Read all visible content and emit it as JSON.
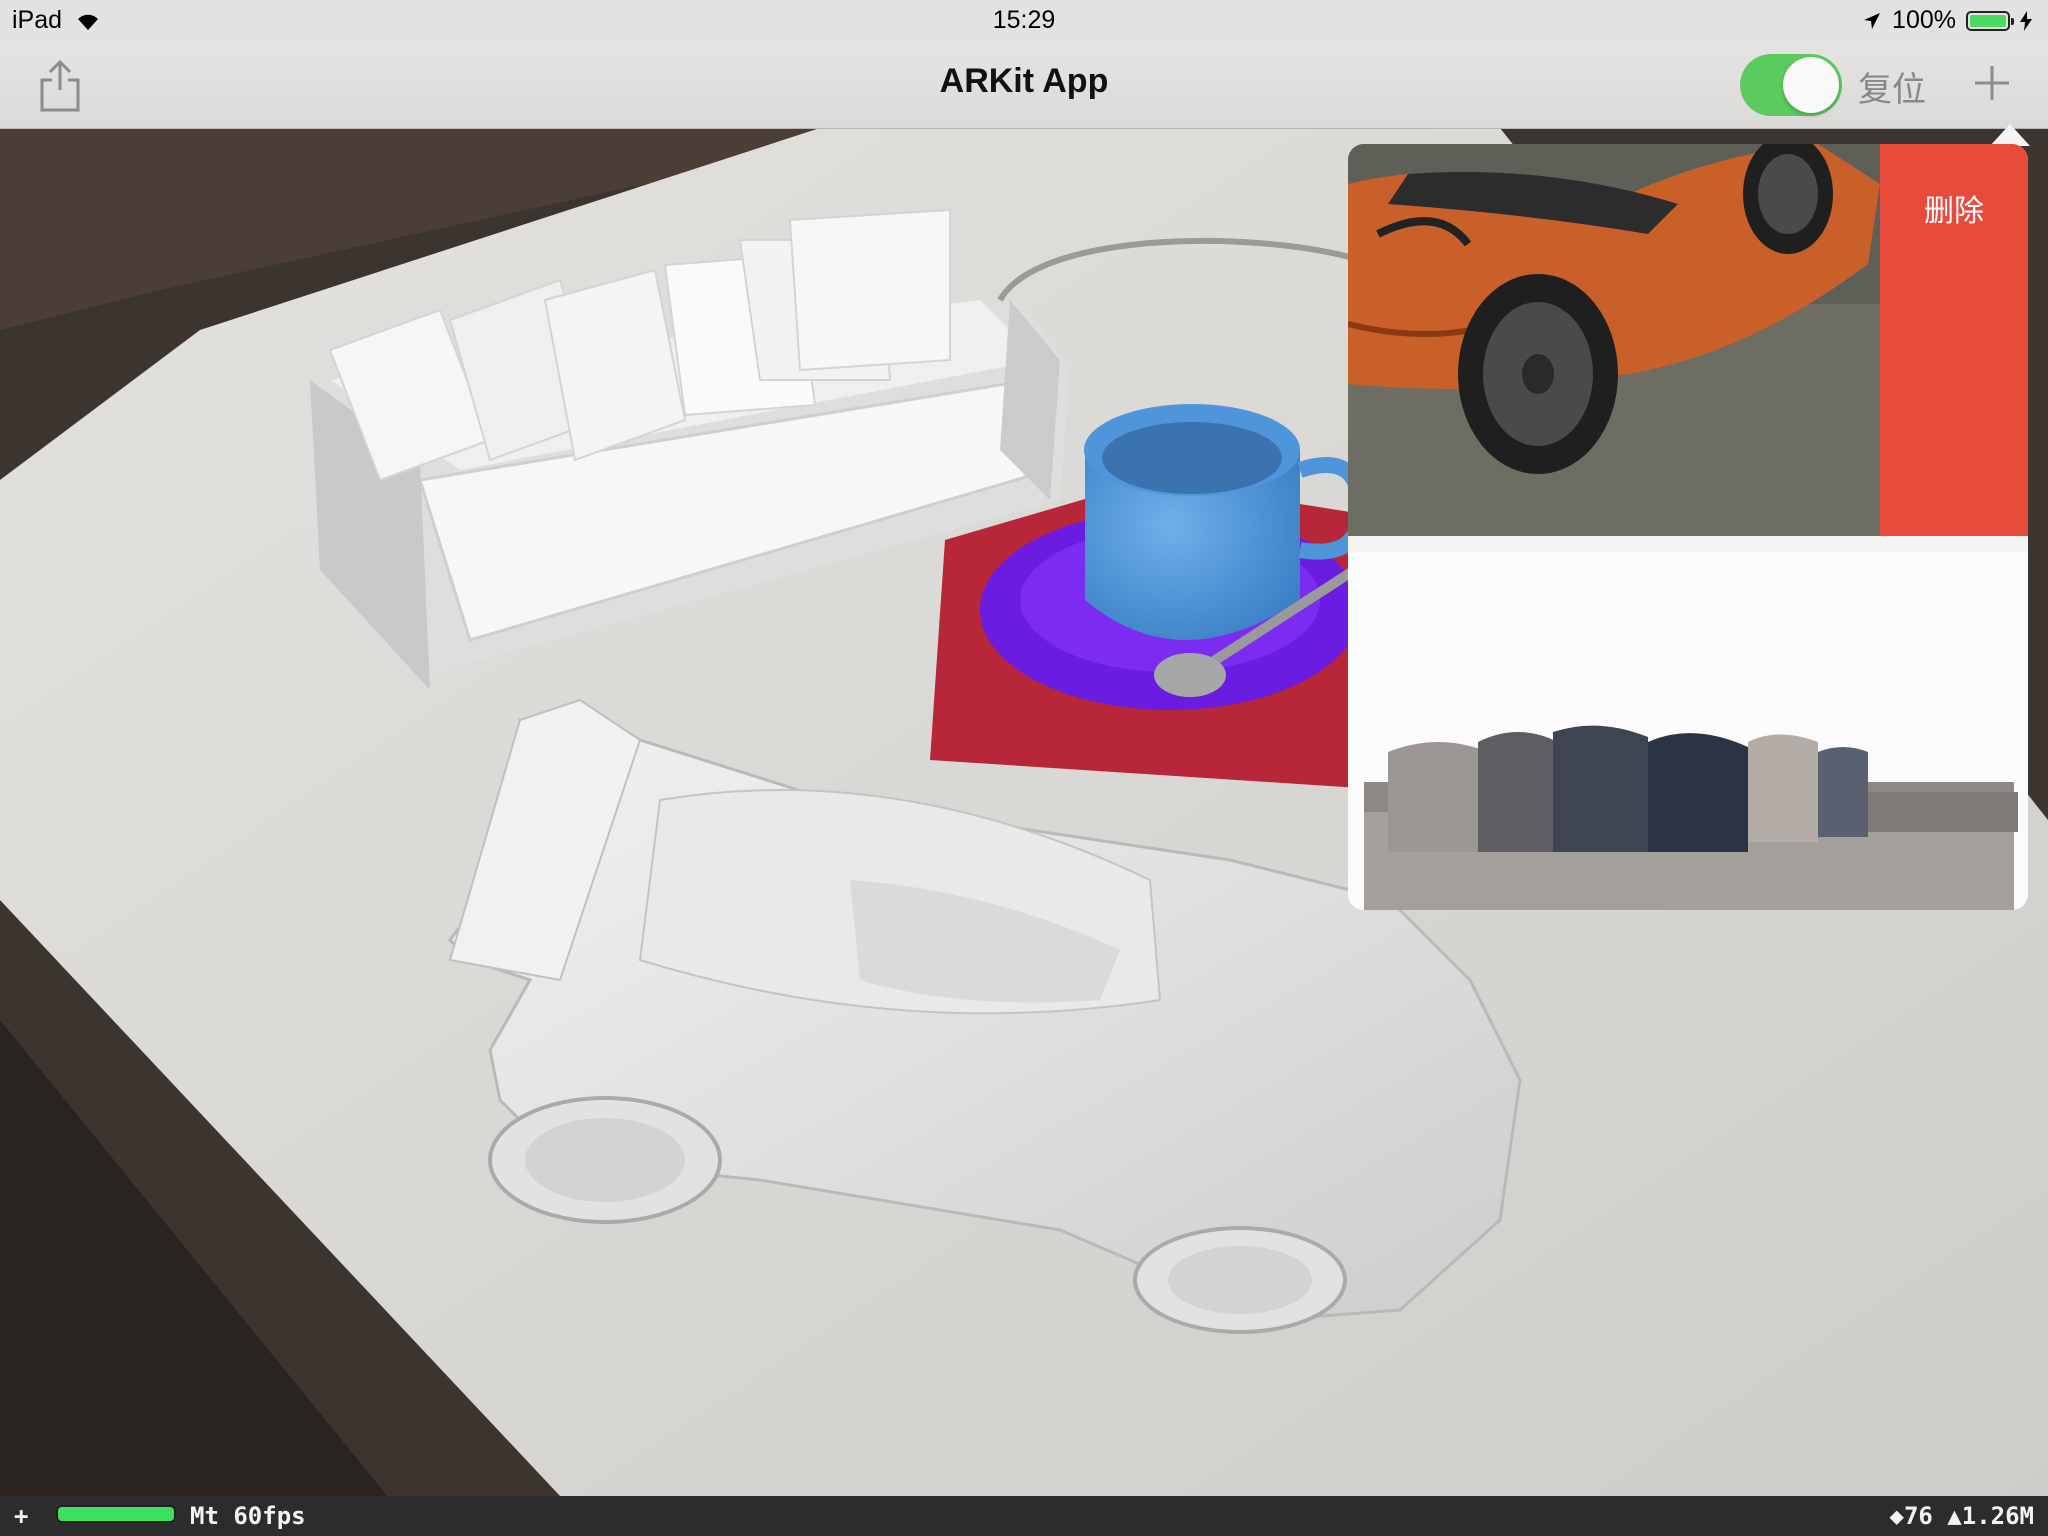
{
  "status_bar": {
    "device": "iPad",
    "time": "15:29",
    "battery": "100%",
    "battery_level": 1.0
  },
  "nav": {
    "title": "ARKit App",
    "toggle_on": true,
    "reset_label": "复位"
  },
  "popover": {
    "delete_label": "删除",
    "items": [
      "car-thumbnail",
      "sofa-thumbnail"
    ]
  },
  "stats": {
    "plus": "+",
    "fps": "Mt 60fps",
    "summary": "◆76 ▲1.26M"
  },
  "colors": {
    "toggle_on": "#5ccb5f",
    "delete": "#e84a3c",
    "battery_fill": "#4cd964",
    "fps_meter": "#3ee05f"
  }
}
